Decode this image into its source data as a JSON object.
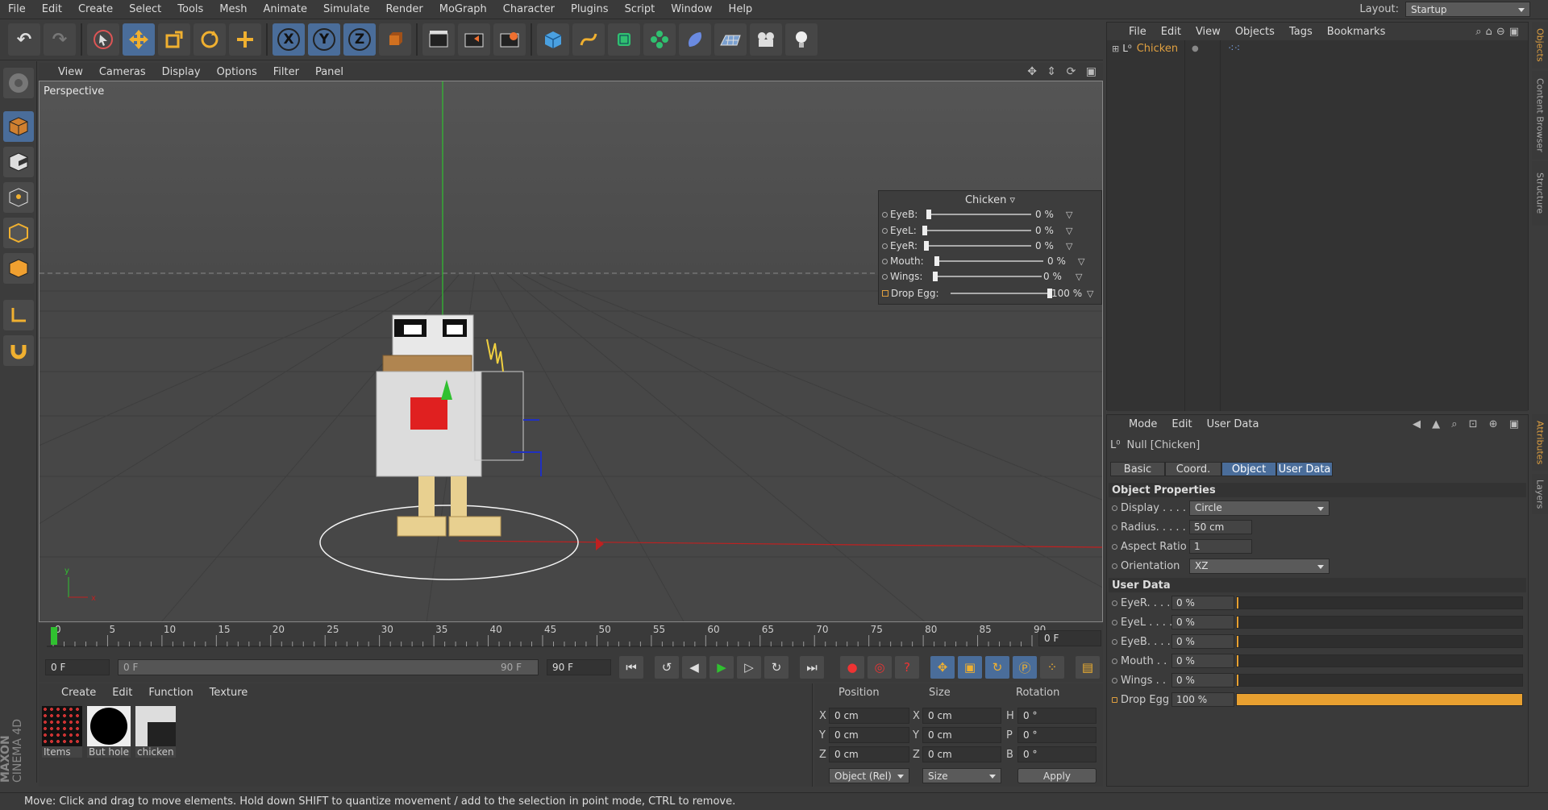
{
  "menubar": {
    "items": [
      "File",
      "Edit",
      "Create",
      "Select",
      "Tools",
      "Mesh",
      "Animate",
      "Simulate",
      "Render",
      "MoGraph",
      "Character",
      "Plugins",
      "Script",
      "Window",
      "Help"
    ],
    "layout_label": "Layout:",
    "layout_value": "Startup"
  },
  "toolbar": {
    "icons": [
      "undo-icon",
      "redo-icon",
      "live-selection-icon",
      "move-icon",
      "scale-icon",
      "rotate-icon",
      "last-tool-icon",
      "x-axis-lock-icon",
      "y-axis-lock-icon",
      "z-axis-lock-icon",
      "coordinate-system-icon",
      "render-view-icon",
      "render-picture-viewer-icon",
      "render-settings-icon",
      "cube-icon",
      "spline-pen-icon",
      "subdivision-surface-icon",
      "cloner-icon",
      "deformer-icon",
      "floor-icon",
      "camera-icon",
      "light-icon"
    ],
    "axis_labels": [
      "X",
      "Y",
      "Z"
    ]
  },
  "left_toolbar": {
    "icons": [
      "make-editable-icon",
      "model-mode-icon",
      "texture-mode-icon",
      "points-mode-icon",
      "edges-mode-icon",
      "polygons-mode-icon",
      "axis-mode-icon",
      "snap-magnet-icon"
    ]
  },
  "viewport": {
    "menu": [
      "View",
      "Cameras",
      "Display",
      "Options",
      "Filter",
      "Panel"
    ],
    "label": "Perspective",
    "axis_gizmo": {
      "x": "x",
      "y": "y"
    }
  },
  "hud": {
    "title": "Chicken",
    "rows": [
      {
        "label": "EyeB:",
        "value": "0 %",
        "level": 0
      },
      {
        "label": "EyeL:",
        "value": "0 %",
        "level": 0
      },
      {
        "label": "EyeR:",
        "value": "0 %",
        "level": 0
      },
      {
        "label": "Mouth:",
        "value": "0 %",
        "level": 0
      },
      {
        "label": "Wings:",
        "value": "0 %",
        "level": 0
      },
      {
        "label": "Drop Egg:",
        "value": "100 %",
        "level": 1
      }
    ]
  },
  "timeline": {
    "ticks": [
      "0",
      "5",
      "10",
      "15",
      "20",
      "25",
      "30",
      "35",
      "40",
      "45",
      "50",
      "55",
      "60",
      "65",
      "70",
      "75",
      "80",
      "85",
      "90"
    ],
    "current_frame": "0 F",
    "start_field": "0 F",
    "range_start": "0 F",
    "range_end": "90 F",
    "end_field": "90 F"
  },
  "material_manager": {
    "menu": [
      "Create",
      "Edit",
      "Function",
      "Texture"
    ],
    "materials": [
      "Items",
      "But hole",
      "chicken"
    ],
    "brand_line1": "MAXON",
    "brand_line2": "CINEMA 4D"
  },
  "coordinates": {
    "headers": [
      "Position",
      "Size",
      "Rotation"
    ],
    "rows": [
      {
        "axis": "X",
        "pos": "0 cm",
        "saxis": "X",
        "size": "0 cm",
        "raxis": "H",
        "rot": "0 °"
      },
      {
        "axis": "Y",
        "pos": "0 cm",
        "saxis": "Y",
        "size": "0 cm",
        "raxis": "P",
        "rot": "0 °"
      },
      {
        "axis": "Z",
        "pos": "0 cm",
        "saxis": "Z",
        "size": "0 cm",
        "raxis": "B",
        "rot": "0 °"
      }
    ],
    "mode": "Object (Rel)",
    "size_mode": "Size",
    "apply_label": "Apply"
  },
  "object_manager": {
    "menu": [
      "File",
      "Edit",
      "View",
      "Objects",
      "Tags",
      "Bookmarks"
    ],
    "object_name": "Chicken"
  },
  "attribute_manager": {
    "menu": [
      "Mode",
      "Edit",
      "User Data"
    ],
    "object_title": "Null [Chicken]",
    "tabs": [
      "Basic",
      "Coord.",
      "Object",
      "User Data"
    ],
    "selected_tabs": [
      "Object",
      "User Data"
    ],
    "object_properties_header": "Object Properties",
    "props": [
      {
        "label": "Display . . . .",
        "value": "Circle",
        "kind": "dropdown"
      },
      {
        "label": "Radius. . . . .",
        "value": "50 cm",
        "kind": "number"
      },
      {
        "label": "Aspect Ratio",
        "value": "1",
        "kind": "number"
      },
      {
        "label": "Orientation",
        "value": "XZ",
        "kind": "dropdown"
      }
    ],
    "user_data_header": "User Data",
    "user_data": [
      {
        "label": "EyeR. . . .",
        "value": "0 %",
        "level": 0
      },
      {
        "label": "EyeL . . . .",
        "value": "0 %",
        "level": 0
      },
      {
        "label": "EyeB. . . .",
        "value": "0 %",
        "level": 0
      },
      {
        "label": "Mouth . .",
        "value": "0 %",
        "level": 0
      },
      {
        "label": "Wings . .",
        "value": "0 %",
        "level": 0
      },
      {
        "label": "Drop Egg",
        "value": "100 %",
        "level": 1
      }
    ]
  },
  "side_tabs_top": [
    "Objects",
    "Content Browser",
    "Structure"
  ],
  "side_tabs_bottom": [
    "Attributes",
    "Layers"
  ],
  "status": "Move: Click and drag to move elements. Hold down SHIFT to quantize movement / add to the selection in point mode, CTRL to remove.",
  "colors": {
    "accent": "#e0a040",
    "selection": "#4a6d9a",
    "axis_x": "#d42020",
    "axis_y": "#20c020"
  }
}
